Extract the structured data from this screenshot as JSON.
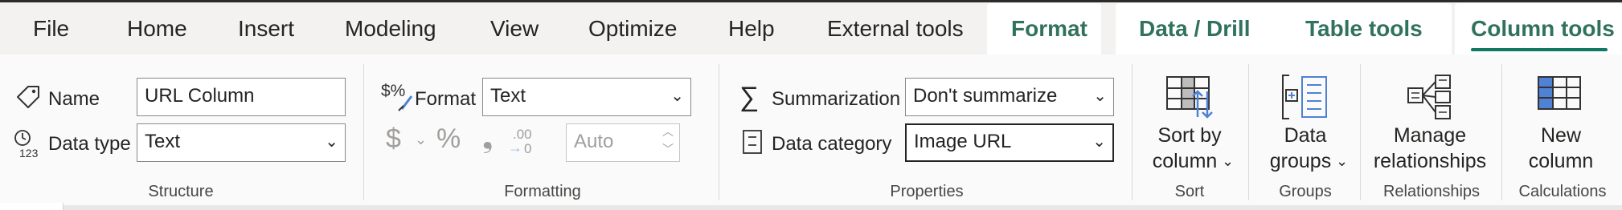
{
  "tabs": {
    "file": "File",
    "home": "Home",
    "insert": "Insert",
    "modeling": "Modeling",
    "view": "View",
    "optimize": "Optimize",
    "help": "Help",
    "external_tools": "External tools",
    "format": "Format",
    "data_drill": "Data / Drill",
    "table_tools": "Table tools",
    "column_tools": "Column tools",
    "active": "Column tools"
  },
  "structure": {
    "group_label": "Structure",
    "name_label": "Name",
    "name_value": "URL Column",
    "data_type_label": "Data type",
    "data_type_value": "Text"
  },
  "formatting": {
    "group_label": "Formatting",
    "format_label": "Format",
    "format_value": "Text",
    "currency_symbol": "$",
    "percent_symbol": "%",
    "comma_symbol": "❟",
    "decimal_symbol": ".00",
    "decimal_places_placeholder": "Auto"
  },
  "properties": {
    "group_label": "Properties",
    "summarization_label": "Summarization",
    "summarization_value": "Don't summarize",
    "data_category_label": "Data category",
    "data_category_value": "Image URL"
  },
  "sort": {
    "group_label": "Sort",
    "line1": "Sort by",
    "line2": "column"
  },
  "groups": {
    "group_label": "Groups",
    "line1": "Data",
    "line2": "groups"
  },
  "relationships": {
    "group_label": "Relationships",
    "line1": "Manage",
    "line2": "relationships"
  },
  "calculations": {
    "group_label": "Calculations",
    "line1": "New",
    "line2": "column"
  },
  "colors": {
    "accent": "#117865",
    "context_tab_text": "#31725f",
    "icon_blue": "#4f81d4",
    "disabled": "#a19f9d"
  },
  "icons": {
    "name": "tag-icon",
    "data_type": "clock-123-icon",
    "format": "dollar-percent-brush-icon",
    "summarization": "sigma-icon",
    "data_category": "category-box-icon",
    "sort": "sort-by-column-icon",
    "groups": "data-groups-icon",
    "relationships": "manage-relationships-icon",
    "calculations": "new-column-icon"
  }
}
